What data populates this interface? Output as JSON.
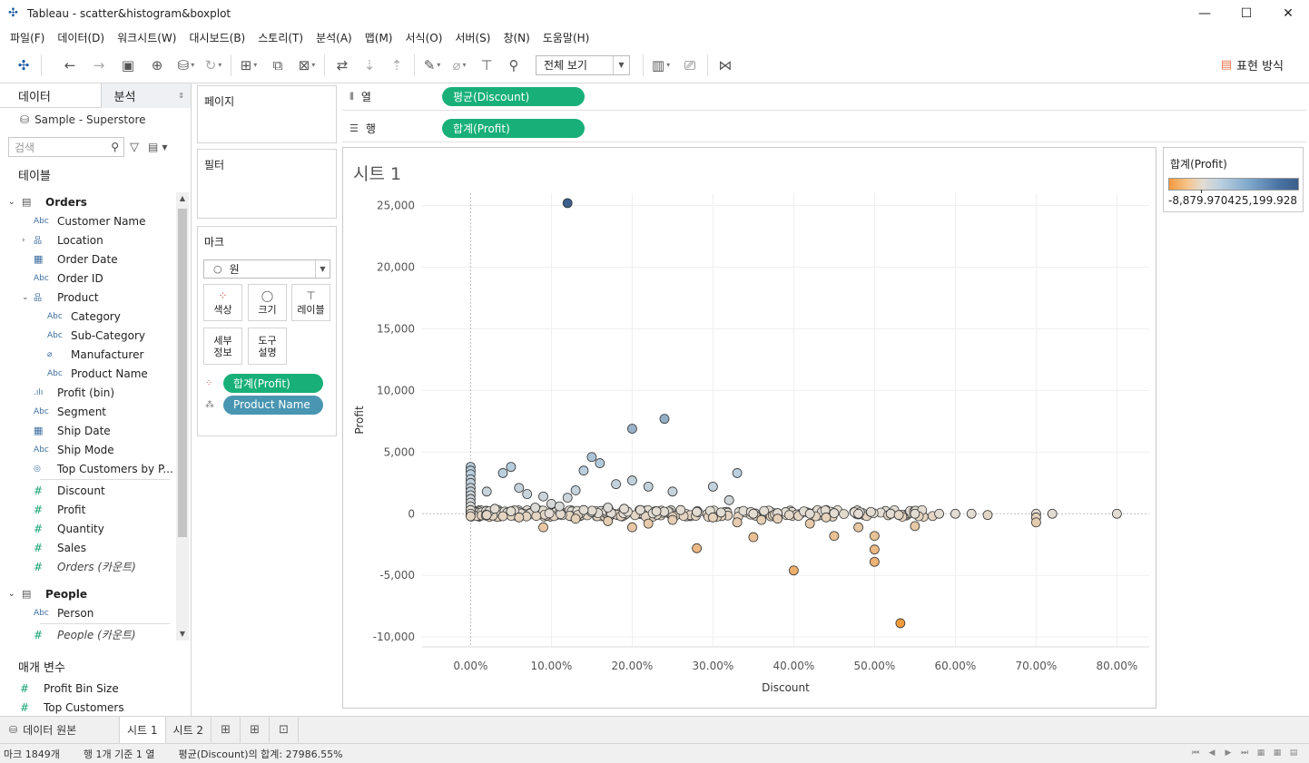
{
  "window": {
    "title": "Tableau - scatter&histogram&boxplot",
    "min": "—",
    "max": "☐",
    "close": "✕"
  },
  "menu": [
    "파일(F)",
    "데이터(D)",
    "워크시트(W)",
    "대시보드(B)",
    "스토리(T)",
    "분석(A)",
    "맵(M)",
    "서식(O)",
    "서버(S)",
    "창(N)",
    "도움말(H)"
  ],
  "toolbar": {
    "fit": "전체 보기",
    "show_me": "표현 방식"
  },
  "data_pane": {
    "tab_data": "데이터",
    "tab_analysis": "분석",
    "datasource": "Sample - Superstore",
    "search_placeholder": "검색",
    "tables_label": "테이블",
    "fields": [
      {
        "kind": "table",
        "label": "Orders",
        "expanded": true
      },
      {
        "kind": "dim",
        "icon": "Abc",
        "label": "Customer Name"
      },
      {
        "kind": "hier",
        "icon": "品",
        "label": "Location",
        "collapsed": true
      },
      {
        "kind": "date",
        "icon": "▦",
        "label": "Order Date"
      },
      {
        "kind": "dim",
        "icon": "Abc",
        "label": "Order ID"
      },
      {
        "kind": "hier",
        "icon": "品",
        "label": "Product",
        "expanded": true
      },
      {
        "kind": "sub",
        "icon": "Abc",
        "label": "Category"
      },
      {
        "kind": "sub",
        "icon": "Abc",
        "label": "Sub-Category"
      },
      {
        "kind": "sub",
        "icon": "⌀",
        "label": "Manufacturer"
      },
      {
        "kind": "sub",
        "icon": "Abc",
        "label": "Product Name"
      },
      {
        "kind": "dim",
        "icon": ".ılı",
        "label": "Profit (bin)"
      },
      {
        "kind": "dim",
        "icon": "Abc",
        "label": "Segment"
      },
      {
        "kind": "date",
        "icon": "▦",
        "label": "Ship Date"
      },
      {
        "kind": "dim",
        "icon": "Abc",
        "label": "Ship Mode"
      },
      {
        "kind": "dim",
        "icon": "◎",
        "label": "Top Customers by P..."
      },
      {
        "kind": "sep"
      },
      {
        "kind": "measure",
        "icon": "#",
        "label": "Discount"
      },
      {
        "kind": "measure",
        "icon": "#",
        "label": "Profit"
      },
      {
        "kind": "measure",
        "icon": "#",
        "label": "Quantity"
      },
      {
        "kind": "measure",
        "icon": "#",
        "label": "Sales"
      },
      {
        "kind": "measure-italic",
        "icon": "#",
        "label": "Orders (카운트)"
      },
      {
        "kind": "gap"
      },
      {
        "kind": "table",
        "label": "People",
        "expanded": true
      },
      {
        "kind": "dim",
        "icon": "Abc",
        "label": "Person"
      },
      {
        "kind": "sep"
      },
      {
        "kind": "measure-italic",
        "icon": "#",
        "label": "People (카운트)"
      }
    ],
    "params_label": "매개 변수",
    "params": [
      {
        "icon": "#",
        "label": "Profit Bin Size"
      },
      {
        "icon": "#",
        "label": "Top Customers"
      }
    ]
  },
  "cards": {
    "pages": "페이지",
    "filters": "필터",
    "marks": "마크",
    "mark_type": "원",
    "mark_buttons": {
      "color": "색상",
      "size": "크기",
      "label": "레이블",
      "detail_1": "세부",
      "detail_2": "정보",
      "tooltip_1": "도구",
      "tooltip_2": "설명"
    },
    "mark_pills": [
      {
        "label": "합계(Profit)",
        "style": "green"
      },
      {
        "label": "Product Name",
        "style": "blue"
      }
    ]
  },
  "shelves": {
    "columns_label": "열",
    "columns_pill": "평균(Discount)",
    "rows_label": "행",
    "rows_pill": "합계(Profit)"
  },
  "sheet": {
    "title": "시트 1"
  },
  "legend": {
    "title": "합계(Profit)",
    "min": "-8,879.9704",
    "max": "25,199.928"
  },
  "colors": {
    "pill_green": "#18b078",
    "pill_blue": "#4996b2",
    "low": "#f39a3e",
    "mid": "#e2dcd3",
    "high": "#3b5f8c"
  },
  "tabs": {
    "datasource": "데이터 원본",
    "sheets": [
      "시트 1",
      "시트 2"
    ]
  },
  "status": {
    "marks": "마크 1849개",
    "rows_cols": "행 1개 기준 1 열",
    "sum": "평균(Discount)의 합계: 27986.55%"
  },
  "chart_data": {
    "type": "scatter",
    "xlabel": "Discount",
    "ylabel": "Profit",
    "x_unit": "percent",
    "xlim": [
      -0.06,
      0.84
    ],
    "ylim": [
      -10800,
      26000
    ],
    "x_ticks": [
      "0.00%",
      "10.00%",
      "20.00%",
      "30.00%",
      "40.00%",
      "50.00%",
      "60.00%",
      "70.00%",
      "80.00%"
    ],
    "y_ticks": [
      "-10,000",
      "-5,000",
      "0",
      "5,000",
      "10,000",
      "15,000",
      "20,000",
      "25,000"
    ],
    "gridlines": true,
    "color_encoding": "합계(Profit)",
    "points": [
      [
        0.12,
        25200
      ],
      [
        0.24,
        7700
      ],
      [
        0.2,
        6900
      ],
      [
        0.15,
        4600
      ],
      [
        0.16,
        4100
      ],
      [
        0.14,
        3500
      ],
      [
        0.33,
        3300
      ],
      [
        0.0,
        3800
      ],
      [
        0.0,
        3500
      ],
      [
        0.0,
        3200
      ],
      [
        0.0,
        2800
      ],
      [
        0.0,
        2500
      ],
      [
        0.0,
        2100
      ],
      [
        0.0,
        1800
      ],
      [
        0.0,
        1500
      ],
      [
        0.0,
        1200
      ],
      [
        0.0,
        900
      ],
      [
        0.0,
        600
      ],
      [
        0.0,
        300
      ],
      [
        0.0,
        0
      ],
      [
        0.0,
        -200
      ],
      [
        0.05,
        3800
      ],
      [
        0.04,
        3300
      ],
      [
        0.02,
        1800
      ],
      [
        0.07,
        1600
      ],
      [
        0.09,
        1400
      ],
      [
        0.12,
        1300
      ],
      [
        0.18,
        2400
      ],
      [
        0.22,
        2200
      ],
      [
        0.2,
        2700
      ],
      [
        0.25,
        1800
      ],
      [
        0.3,
        2200
      ],
      [
        0.32,
        1100
      ],
      [
        0.13,
        1900
      ],
      [
        0.06,
        2100
      ],
      [
        0.1,
        800
      ],
      [
        0.11,
        600
      ],
      [
        0.08,
        500
      ],
      [
        0.03,
        400
      ],
      [
        0.05,
        200
      ],
      [
        0.14,
        300
      ],
      [
        0.17,
        500
      ],
      [
        0.19,
        400
      ],
      [
        0.21,
        300
      ],
      [
        0.23,
        200
      ],
      [
        0.26,
        300
      ],
      [
        0.28,
        150
      ],
      [
        0.31,
        100
      ],
      [
        0.35,
        0
      ],
      [
        0.38,
        50
      ],
      [
        0.42,
        0
      ],
      [
        0.45,
        50
      ],
      [
        0.48,
        0
      ],
      [
        0.52,
        0
      ],
      [
        0.55,
        0
      ],
      [
        0.58,
        0
      ],
      [
        0.6,
        0
      ],
      [
        0.62,
        0
      ],
      [
        0.64,
        -100
      ],
      [
        0.7,
        0
      ],
      [
        0.7,
        -300
      ],
      [
        0.7,
        -700
      ],
      [
        0.72,
        0
      ],
      [
        0.8,
        0
      ],
      [
        0.52,
        0
      ],
      [
        0.53,
        -100
      ],
      [
        0.02,
        -100
      ],
      [
        0.04,
        -200
      ],
      [
        0.06,
        -300
      ],
      [
        0.09,
        -1100
      ],
      [
        0.13,
        -400
      ],
      [
        0.17,
        -600
      ],
      [
        0.2,
        -1100
      ],
      [
        0.22,
        -800
      ],
      [
        0.25,
        -500
      ],
      [
        0.28,
        -2800
      ],
      [
        0.35,
        -1900
      ],
      [
        0.4,
        -4600
      ],
      [
        0.42,
        -800
      ],
      [
        0.45,
        -1800
      ],
      [
        0.48,
        -1100
      ],
      [
        0.5,
        -1800
      ],
      [
        0.5,
        -3900
      ],
      [
        0.5,
        -2900
      ],
      [
        0.532,
        -8880
      ],
      [
        0.55,
        -1000
      ],
      [
        0.36,
        -500
      ],
      [
        0.3,
        -300
      ],
      [
        0.33,
        -700
      ],
      [
        0.38,
        -400
      ],
      [
        0.44,
        -300
      ]
    ]
  }
}
